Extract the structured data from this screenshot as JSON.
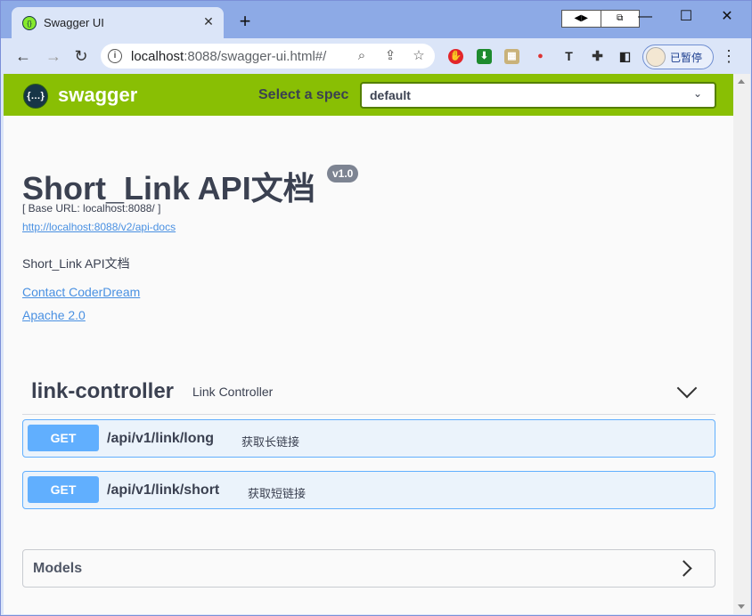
{
  "browser": {
    "tab_title": "Swagger UI",
    "new_tab": "+",
    "url_host": "localhost",
    "url_rest": ":8088/swagger-ui.html#/",
    "profile_label": "已暂停"
  },
  "swagger": {
    "brand": "swagger",
    "spec_label": "Select a spec",
    "spec_value": "default",
    "title": "Short_Link API文档",
    "version": "v1.0",
    "base_url": "[ Base URL: localhost:8088/ ]",
    "api_docs_url": "http://localhost:8088/v2/api-docs",
    "description": "Short_Link API文档",
    "contact": "Contact CoderDream",
    "license": "Apache 2.0",
    "tag": {
      "name": "link-controller",
      "description": "Link Controller"
    },
    "operations": [
      {
        "method": "GET",
        "path": "/api/v1/link/long",
        "summary": "获取长链接"
      },
      {
        "method": "GET",
        "path": "/api/v1/link/short",
        "summary": "获取短链接"
      }
    ],
    "models_label": "Models"
  }
}
